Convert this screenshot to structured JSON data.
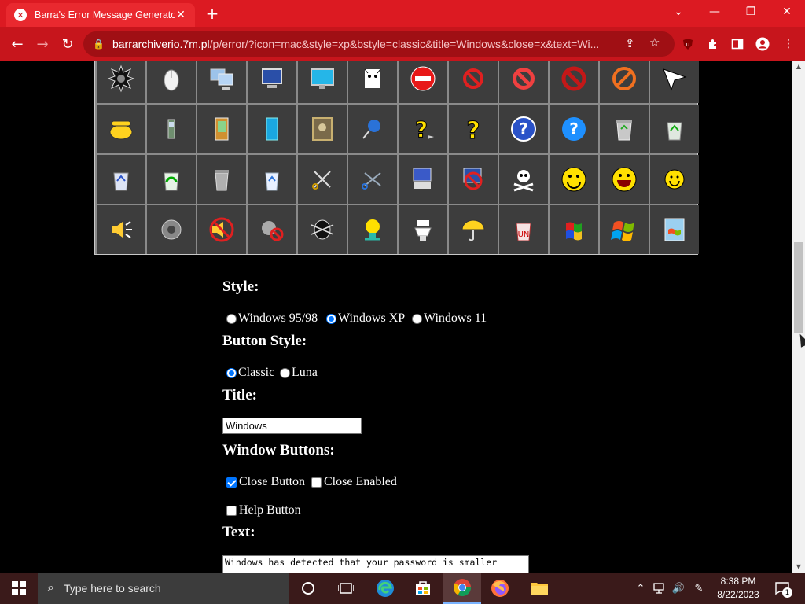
{
  "browser": {
    "tab_title": "Barra's Error Message Generator",
    "tab_close": "✕",
    "new_tab": "+",
    "url_host": "barrarchiverio.7m.pl",
    "url_path": "/p/error/?icon=mac&style=xp&bstyle=classic&title=Windows&close=x&text=Wi...",
    "window_controls": {
      "dropdown": "⌄",
      "minimize": "—",
      "restore": "❐",
      "close": "✕"
    },
    "nav": {
      "back": "←",
      "forward": "→",
      "reload": "↻"
    },
    "accent": "#dc1a22"
  },
  "icons": [
    "gear-burst",
    "mouse",
    "computers",
    "monitor-pc",
    "monitor",
    "cat-warning",
    "no-entry",
    "no-symbol-small",
    "no-symbol",
    "no-symbol-red",
    "no-symbol-orange",
    "cursor-arrow",
    "telephone",
    "cell-phone",
    "pda",
    "cyan-device",
    "picture-frame",
    "pushpin",
    "question-yellow-arrow",
    "question-yellow",
    "question-blue-circle",
    "question-blue",
    "recycle-bin-full",
    "recycle-bin-green",
    "recycle-bin-blue",
    "recycle-bin-green-2",
    "trash-can",
    "recycle-bin-empty",
    "scissors",
    "scissors-blue",
    "computer-disk",
    "computer-denied",
    "skull-crossbones",
    "smiley",
    "smiley-grin",
    "smiley-small",
    "speaker-loud",
    "speaker",
    "speaker-muted",
    "speaker-denied",
    "bug",
    "lightbulb-warning",
    "toilet",
    "umbrella",
    "recycle-bin-red",
    "windows-flag-old",
    "windows-xp-logo",
    "windows-picture"
  ],
  "form": {
    "style_heading": "Style:",
    "style_options": [
      "Windows 95/98",
      "Windows XP",
      "Windows 11"
    ],
    "style_selected": "Windows XP",
    "button_style_heading": "Button Style:",
    "button_style_options": [
      "Classic",
      "Luna"
    ],
    "button_style_selected": "Classic",
    "title_heading": "Title:",
    "title_value": "Windows",
    "window_buttons_heading": "Window Buttons:",
    "close_button": "Close Button",
    "close_enabled": "Close Enabled",
    "help_button": "Help Button",
    "close_button_checked": true,
    "close_enabled_checked": false,
    "help_button_checked": false,
    "text_heading": "Text:",
    "text_value": "Windows has detected that your password is smaller"
  },
  "taskbar": {
    "search_placeholder": "Type here to search",
    "time": "8:38 PM",
    "date": "8/22/2023",
    "notification_count": "1"
  }
}
